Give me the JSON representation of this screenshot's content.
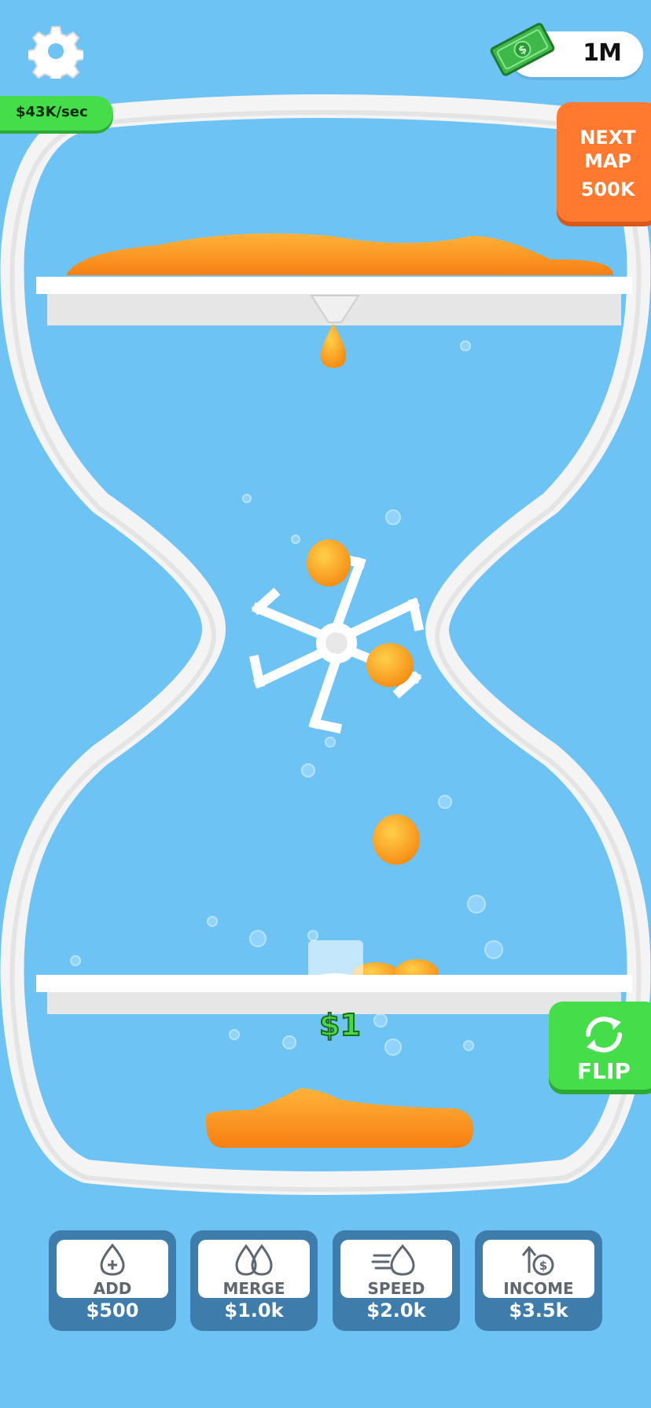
{
  "hud": {
    "cash": "1M",
    "rate": "$43K/sec"
  },
  "next_map": {
    "line1": "NEXT",
    "line2": "MAP",
    "cost": "500K"
  },
  "flip": {
    "label": "FLIP"
  },
  "popup": {
    "value": "$1"
  },
  "upgrades": [
    {
      "label": "ADD",
      "price": "$500",
      "icon": "drop-plus-icon"
    },
    {
      "label": "MERGE",
      "price": "$1.0k",
      "icon": "drops-merge-icon"
    },
    {
      "label": "SPEED",
      "price": "$2.0k",
      "icon": "drop-speed-icon"
    },
    {
      "label": "INCOME",
      "price": "$3.5k",
      "icon": "income-arrow-icon"
    }
  ],
  "colors": {
    "background": "#6ec3f5",
    "green_button": "#45dd4a",
    "orange_button": "#ff7a2e",
    "upgrade_button": "#3e7cab",
    "liquid": "#ff9a1f"
  }
}
